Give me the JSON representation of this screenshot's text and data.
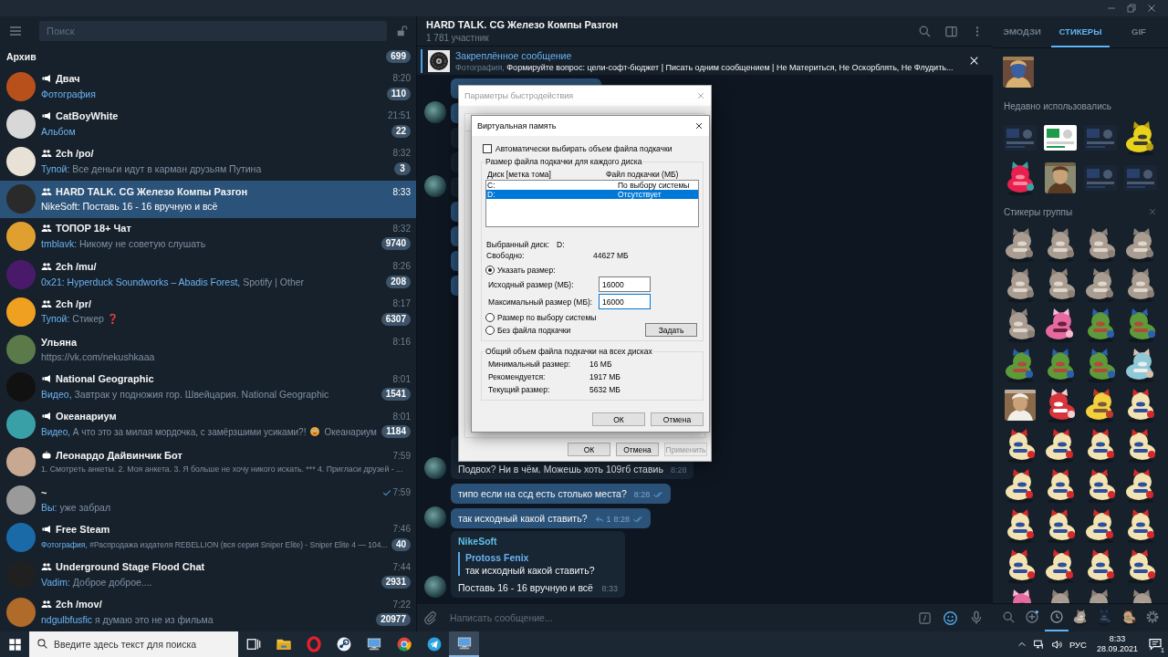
{
  "sidebar": {
    "search": {
      "placeholder": "Поиск"
    },
    "archive": {
      "label": "Архив",
      "count": "699"
    },
    "chats": [
      {
        "name": "Двач",
        "kind": "channel",
        "color": "#b8501c",
        "time": "8:20",
        "preview": {
          "prefix": "Фотография"
        },
        "badge": "110",
        "selected": false
      },
      {
        "name": "CatBoyWhite",
        "kind": "channel",
        "color": "#d8d8d8",
        "time": "21:51",
        "preview": {
          "prefix": "Альбом"
        },
        "badge": "22",
        "selected": false
      },
      {
        "name": "2ch /po/",
        "kind": "group",
        "color": "#e8e2d6",
        "time": "8:32",
        "preview": {
          "prefix": "Тупой:",
          "text": "Все деньги идут в карман друзьям Путина"
        },
        "badge": "3",
        "selected": false
      },
      {
        "name": "HARD TALK. CG Железо Компы Разгон",
        "kind": "group",
        "color": "#2a2a2a",
        "time": "8:33",
        "preview": {
          "prefix": "NikeSoft:",
          "text": "Поставь 16 - 16 вручную и всё"
        },
        "selected": true
      },
      {
        "name": "ТОПОР 18+ Чат",
        "kind": "group",
        "color": "#e0a030",
        "time": "8:32",
        "preview": {
          "prefix": "tmblavk:",
          "text": "Никому не советую слушать"
        },
        "badge": "9740",
        "selected": false
      },
      {
        "name": "2ch /mu/",
        "kind": "group",
        "color": "#4a1a6a",
        "time": "8:26",
        "preview": {
          "prefix": "0x21: Hyperduck Soundworks – Abadis Forest,",
          "text": "Spotify | Other"
        },
        "badge": "208",
        "selected": false
      },
      {
        "name": "2ch /pr/",
        "kind": "group",
        "color": "#f0a020",
        "time": "8:17",
        "preview": {
          "prefix": "Тупой:",
          "text": "Стикер",
          "mark": "❓"
        },
        "badge": "6307",
        "selected": false
      },
      {
        "name": "Ульяна",
        "kind": "none",
        "color": "#5a7a4a",
        "time": "8:16",
        "preview": {
          "text": "https://vk.com/nekushkaaa"
        },
        "selected": false
      },
      {
        "name": "National Geographic",
        "kind": "channel",
        "color": "#111111",
        "time": "8:01",
        "preview": {
          "prefix": "Видео,",
          "text": "Завтрак у подножия гор. Швейцария.  National Geographic"
        },
        "badge": "1541",
        "selected": false
      },
      {
        "name": "Океанариум",
        "kind": "channel",
        "color": "#3aa0a8",
        "time": "8:01",
        "preview": {
          "prefix": "Видео,",
          "text": "А что это за милая мордочка, с замёрзшими усиками?!",
          "emoji": true,
          "suffix": "Океанариум"
        },
        "badge": "1184",
        "selected": false
      },
      {
        "name": "Леонардо Дайвинчик Бот",
        "kind": "bot",
        "color": "#c8a890",
        "time": "7:59",
        "preview": {
          "text": "1. Смотреть анкеты. 2. Моя анкета. 3. Я больше не хочу никого искать. *** 4. Пригласи друзей - ..."
        },
        "selected": false
      },
      {
        "name": "~",
        "kind": "none",
        "color": "#9a9a9a",
        "time": "7:59",
        "sent": true,
        "preview": {
          "prefix": "Вы:",
          "text": "уже забрал"
        },
        "selected": false
      },
      {
        "name": "Free Steam",
        "kind": "channel",
        "color": "#1a6aa8",
        "time": "7:46",
        "preview": {
          "prefix": "Фотография,",
          "text": "#Распродажа издателя REBELLION (вся серия Sniper Elite)  - Sniper Elite 4 — 104..."
        },
        "badge": "40",
        "selected": false
      },
      {
        "name": "Underground Stage Flood Chat",
        "kind": "group",
        "color": "#202020",
        "time": "7:44",
        "preview": {
          "prefix": "Vadim:",
          "text": "Доброе доброе...."
        },
        "badge": "2931",
        "selected": false
      },
      {
        "name": "2ch /mov/",
        "kind": "group",
        "color": "#b06a2a",
        "time": "7:22",
        "preview": {
          "prefix": "ndgulbfusfic",
          "text": "я думаю это не из фильма"
        },
        "badge": "20977",
        "selected": false
      }
    ]
  },
  "chat": {
    "title": "HARD TALK. CG Железо Компы Разгон",
    "subtitle": "1 781 участник",
    "pinned": {
      "label": "Закреплённое сообщение",
      "prefix": "Фотография,",
      "text": "Формируйте вопрос: цели-софт-бюджет | Писать одним сообщением | Не Материться, Не Оскорблять, Не Флудить..."
    },
    "messages": [
      {
        "kind": "covered",
        "outgoing": true,
        "avatar": false
      },
      {
        "kind": "covered",
        "outgoing": true,
        "avatar": true
      },
      {
        "kind": "covered",
        "outgoing": false,
        "avatar": false
      },
      {
        "kind": "covered",
        "outgoing": false,
        "avatar": false
      },
      {
        "kind": "covered",
        "outgoing": false,
        "avatar": true
      },
      {
        "kind": "covered",
        "outgoing": true,
        "avatar": false
      },
      {
        "kind": "covered",
        "outgoing": true,
        "avatar": false
      },
      {
        "kind": "covered",
        "outgoing": true,
        "avatar": false
      },
      {
        "kind": "covered",
        "outgoing": true,
        "avatar": false
      },
      {
        "kind": "text",
        "outgoing": false,
        "avatar": true,
        "text": "Подвох? Ни в чём. Можешь хоть 109гб ставиь",
        "time": "8:28"
      },
      {
        "kind": "text",
        "outgoing": true,
        "avatar": false,
        "text": "типо если на ссд есть столько места?",
        "time": "8:28",
        "read": true
      },
      {
        "kind": "text",
        "outgoing": true,
        "avatar": true,
        "text": "так исходный какой ставить?",
        "replies": "1",
        "time": "8:28",
        "read": true
      },
      {
        "kind": "reply",
        "outgoing": false,
        "avatar": true,
        "sender": "NikeSoft",
        "quote_author": "Protoss Fenix",
        "quote": "так исходный какой ставить?",
        "text": "Поставь 16 - 16 вручную и всё",
        "time": "8:33"
      }
    ],
    "composer": {
      "placeholder": "Написать сообщение..."
    }
  },
  "performance_dialog": {
    "title": "Параметры быстродействия",
    "buttons": [
      {
        "label": "ОК",
        "disabled": false
      },
      {
        "label": "Отмена",
        "disabled": false
      },
      {
        "label": "Применить",
        "disabled": true
      }
    ]
  },
  "virtual_memory_dialog": {
    "title": "Виртуальная память",
    "auto_manage": {
      "label": "Автоматически выбирать объем файла подкачки",
      "checked": false
    },
    "drives_group": {
      "title": "Размер файла подкачки для каждого диска",
      "columns": [
        "Диск [метка тома]",
        "Файл подкачки (МБ)"
      ],
      "rows": [
        {
          "drive": "C:",
          "paging": "По выбору системы",
          "selected": false
        },
        {
          "drive": "D:",
          "paging": "Отсутствует",
          "selected": true
        }
      ],
      "info": [
        {
          "label": "Выбранный диск:",
          "value": "D:"
        },
        {
          "label": "Свободно:",
          "value": "44627 МБ"
        }
      ],
      "options": [
        {
          "label": "Указать размер:",
          "selected": true
        },
        {
          "label": "Размер по выбору системы",
          "selected": false
        },
        {
          "label": "Без файла подкачки",
          "selected": false
        }
      ],
      "fields": [
        {
          "label": "Исходный размер (МБ):",
          "value": "16000",
          "focused": false
        },
        {
          "label": "Максимальный размер (МБ):",
          "value": "16000",
          "focused": true
        }
      ],
      "set_button": "Задать"
    },
    "totals_group": {
      "title": "Общий объем файла подкачки на всех дисках",
      "rows": [
        {
          "label": "Минимальный размер:",
          "value": "16 МБ"
        },
        {
          "label": "Рекомендуется:",
          "value": "1917 МБ"
        },
        {
          "label": "Текущий размер:",
          "value": "5632 МБ"
        }
      ]
    },
    "buttons": [
      "ОК",
      "Отмена"
    ]
  },
  "sticker_panel": {
    "tabs": [
      {
        "label": "ЭМОДЗИ",
        "selected": false
      },
      {
        "label": "СТИКЕРЫ",
        "selected": true
      },
      {
        "label": "GIF",
        "selected": false
      }
    ],
    "recent_title": "Недавно использовались",
    "group_title": "Стикеры группы",
    "tools": [
      {
        "kind": "search",
        "selected": false
      },
      {
        "kind": "add",
        "selected": false
      },
      {
        "kind": "recent",
        "selected": true
      },
      {
        "kind": "set",
        "selected": false
      },
      {
        "kind": "set",
        "selected": false
      },
      {
        "kind": "set",
        "selected": false
      },
      {
        "kind": "settings",
        "selected": false
      }
    ]
  },
  "taskbar": {
    "search": {
      "placeholder": "Введите здесь текст для поиска"
    },
    "apps": [
      {
        "kind": "task-view",
        "active": false
      },
      {
        "kind": "folder",
        "active": false
      },
      {
        "kind": "opera",
        "active": false
      },
      {
        "kind": "steam",
        "active": false
      },
      {
        "kind": "computer",
        "active": false
      },
      {
        "kind": "chrome",
        "active": false
      },
      {
        "kind": "telegram",
        "active": false
      },
      {
        "kind": "computer",
        "active": true
      }
    ],
    "tray": {
      "language": "РУС",
      "time": "8:33",
      "date": "28.09.2021",
      "notifications": "1"
    }
  }
}
